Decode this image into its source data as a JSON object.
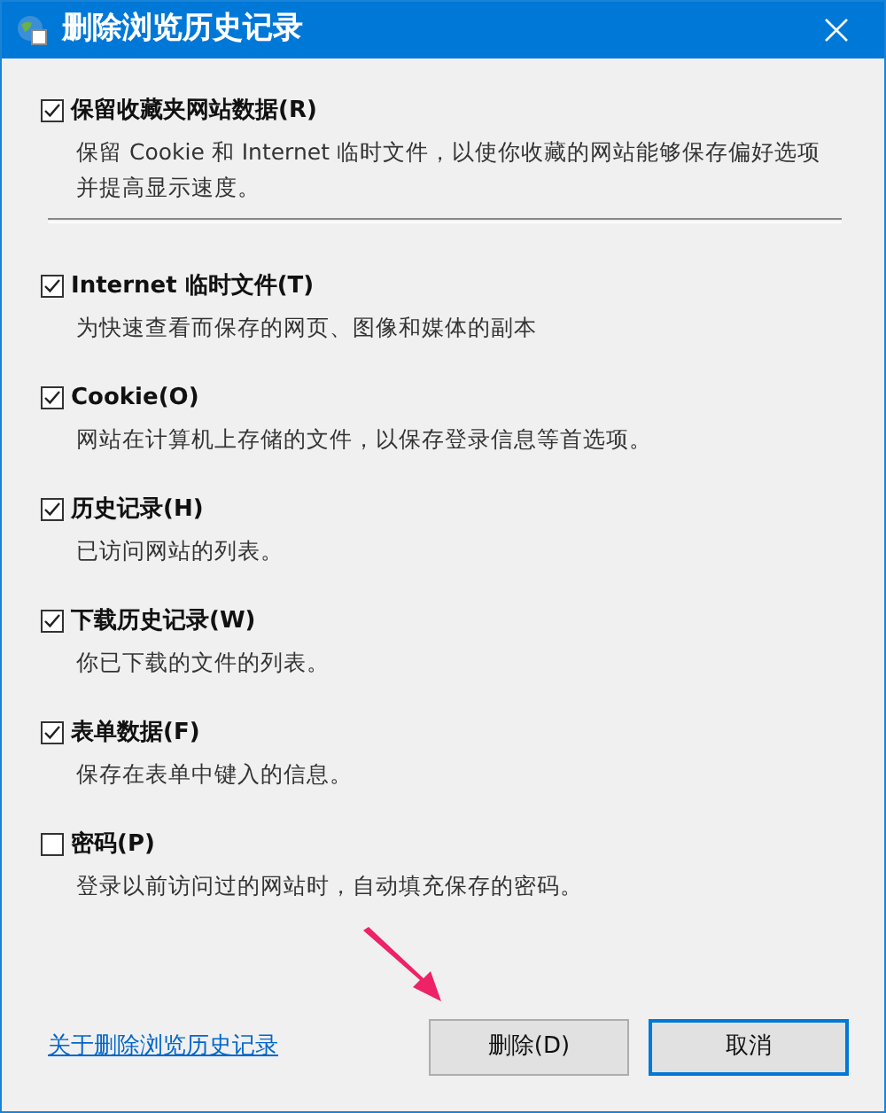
{
  "window": {
    "title": "删除浏览历史记录"
  },
  "options": [
    {
      "label": "保留收藏夹网站数据(R)",
      "checked": true,
      "description": "保留 Cookie 和 Internet 临时文件，以使你收藏的网站能够保存偏好选项并提高显示速度。"
    },
    {
      "label": "Internet 临时文件(T)",
      "checked": true,
      "description": "为快速查看而保存的网页、图像和媒体的副本"
    },
    {
      "label": "Cookie(O)",
      "checked": true,
      "description": "网站在计算机上存储的文件，以保存登录信息等首选项。"
    },
    {
      "label": "历史记录(H)",
      "checked": true,
      "description": "已访问网站的列表。"
    },
    {
      "label": "下载历史记录(W)",
      "checked": true,
      "description": "你已下载的文件的列表。"
    },
    {
      "label": "表单数据(F)",
      "checked": true,
      "description": "保存在表单中键入的信息。"
    },
    {
      "label": "密码(P)",
      "checked": false,
      "description": "登录以前访问过的网站时，自动填充保存的密码。"
    }
  ],
  "help_link": "关于删除浏览历史记录",
  "buttons": [
    {
      "label": "删除(D)",
      "kind": "normal"
    },
    {
      "label": "取消",
      "kind": "default"
    }
  ]
}
